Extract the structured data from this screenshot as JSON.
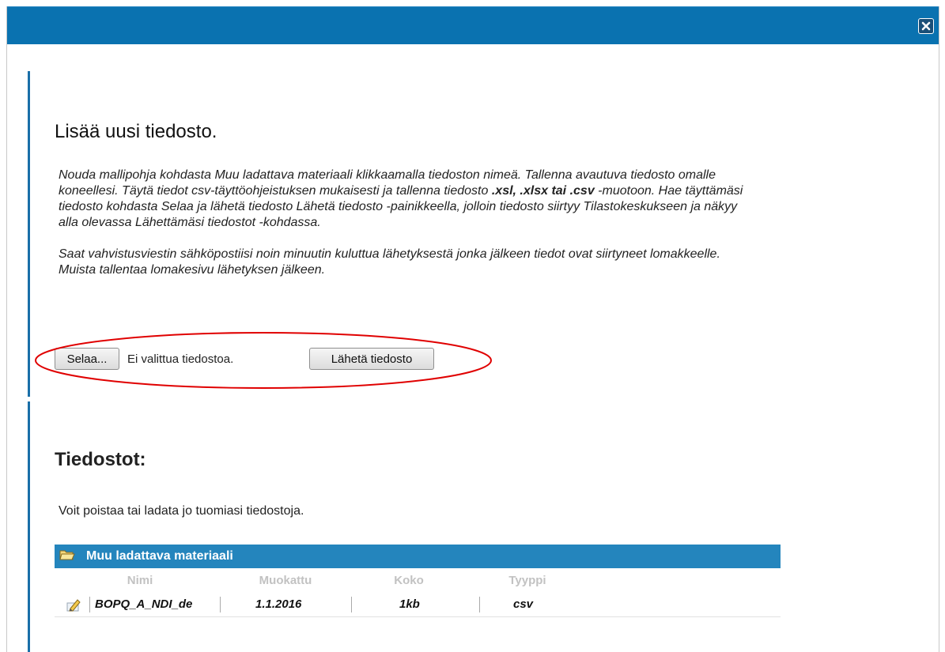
{
  "dialog": {
    "close_label": "×"
  },
  "upload_section": {
    "title": "Lisää uusi tiedosto.",
    "instructions_p1_a": "Nouda mallipohja kohdasta Muu ladattava materiaali klikkaamalla tiedoston nimeä. Tallenna avautuva tiedosto omalle koneellesi. Täytä tiedot csv-täyttöohjeistuksen mukaisesti ja tallenna tiedosto ",
    "instructions_p1_bold": ".xsl, .xlsx tai .csv",
    "instructions_p1_b": " -muotoon. Hae täyttämäsi tiedosto kohdasta Selaa ja lähetä tiedosto Lähetä tiedosto -painikkeella, jolloin tiedosto siirtyy Tilastokeskukseen ja näkyy alla olevassa Lähettämäsi tiedostot -kohdassa.",
    "instructions_p2": "Saat vahvistusviestin sähköpostiisi noin minuutin kuluttua lähetyksestä jonka jälkeen tiedot ovat siirtyneet lomakkeelle. Muista tallentaa lomakesivu lähetyksen jälkeen.",
    "browse_label": "Selaa...",
    "no_file_text": "Ei valittua tiedostoa.",
    "send_label": "Lähetä tiedosto",
    "annotation_color": "#e00000"
  },
  "files_section": {
    "title": "Tiedostot:",
    "info": "Voit poistaa tai ladata jo tuomiasi tiedostoja.",
    "table": {
      "group_title": "Muu ladattava materiaali",
      "columns": [
        "Nimi",
        "Muokattu",
        "Koko",
        "Tyyppi"
      ],
      "rows": [
        {
          "name": "BOPQ_A_NDI_de",
          "modified": "1.1.2016",
          "size": "1kb",
          "type": "csv"
        }
      ]
    }
  },
  "colors": {
    "titlebar": "#0a72b0",
    "table_header": "#2485bd",
    "section_bar": "#1a6fa8"
  }
}
